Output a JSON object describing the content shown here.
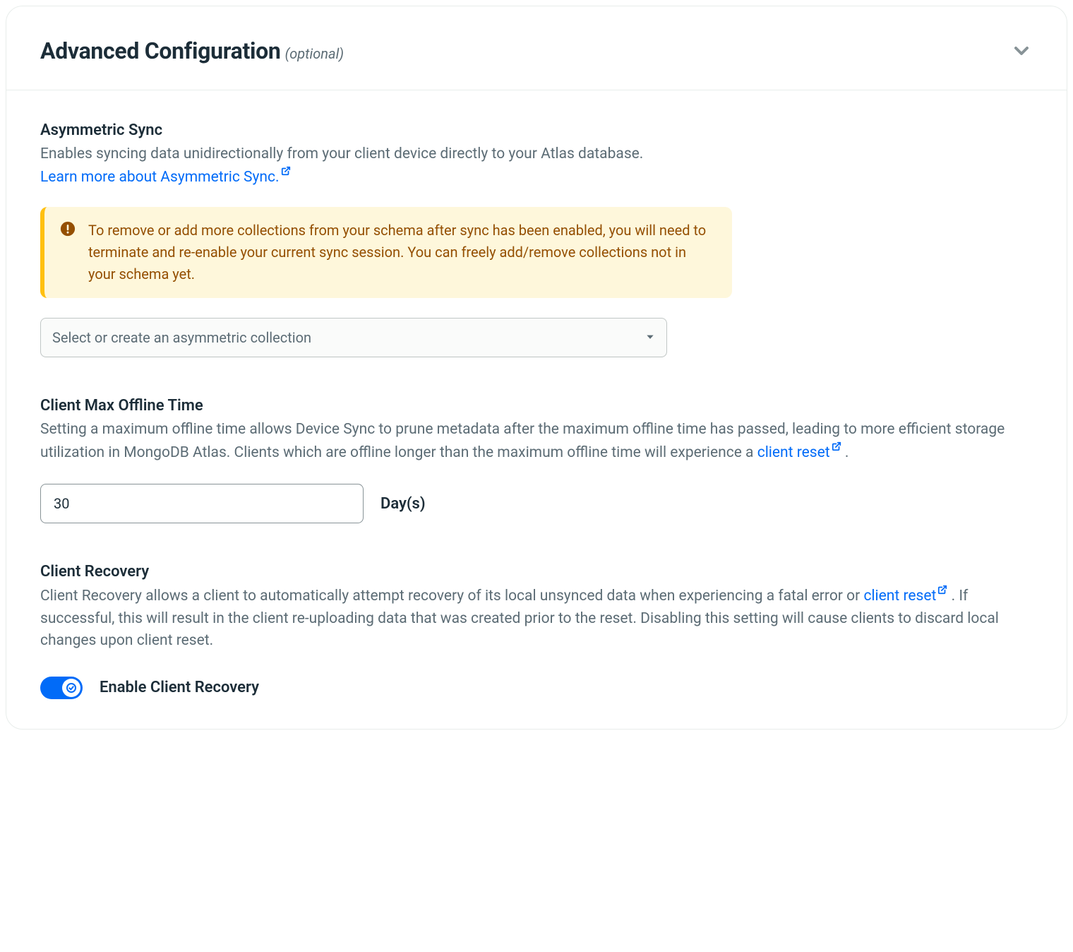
{
  "header": {
    "title": "Advanced Configuration",
    "optional": "(optional)"
  },
  "async": {
    "title": "Asymmetric Sync",
    "desc": "Enables syncing data unidirectionally from your client device directly to your Atlas database.",
    "learnMore": "Learn more about Asymmetric Sync.",
    "alert": "To remove or add more collections from your schema after sync has been enabled, you will need to terminate and re-enable your current sync session. You can freely add/remove collections not in your schema yet.",
    "selectPlaceholder": "Select or create an asymmetric collection"
  },
  "offline": {
    "title": "Client Max Offline Time",
    "descPre": "Setting a maximum offline time allows Device Sync to prune metadata after the maximum offline time has passed, leading to more efficient storage utilization in MongoDB Atlas. Clients which are offline longer than the maximum offline time will experience a ",
    "link": "client reset",
    "descPost": " .",
    "value": "30",
    "unit": "Day(s)"
  },
  "recovery": {
    "title": "Client Recovery",
    "descPre": "Client Recovery allows a client to automatically attempt recovery of its local unsynced data when experiencing a fatal error or ",
    "link": "client reset",
    "descPost": " . If successful, this will result in the client re-uploading data that was created prior to the reset. Disabling this setting will cause clients to discard local changes upon client reset.",
    "toggleLabel": "Enable Client Recovery"
  }
}
